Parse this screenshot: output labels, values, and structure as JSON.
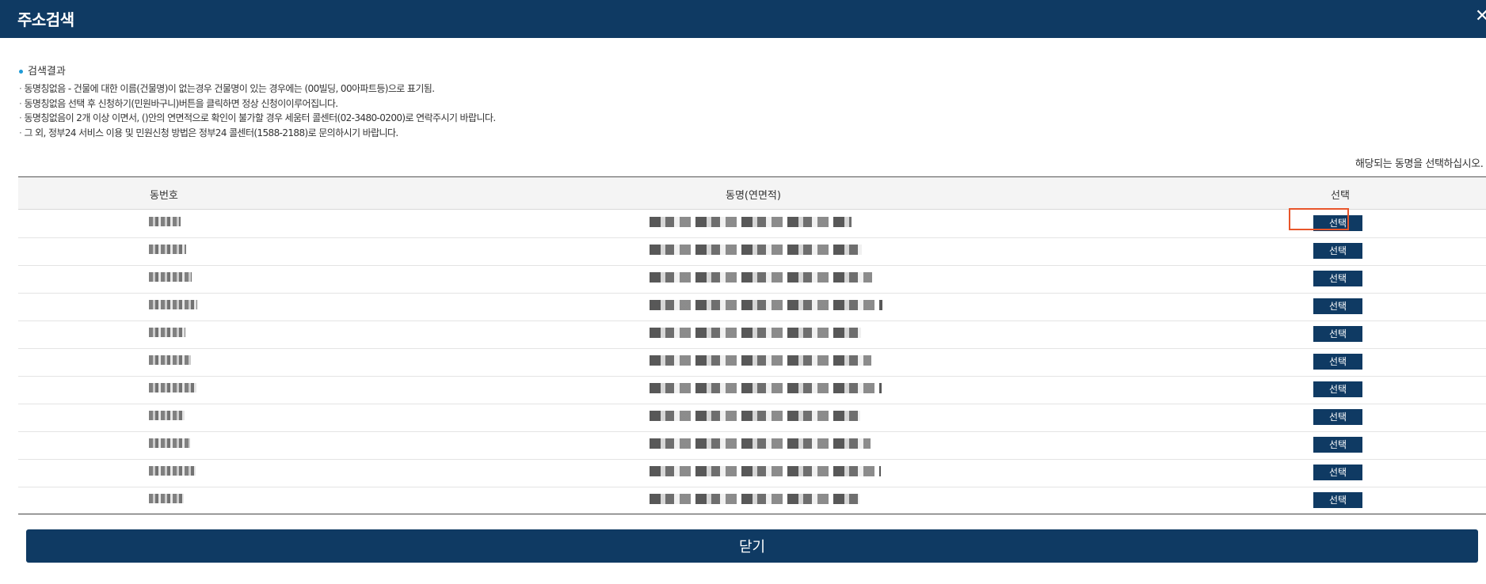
{
  "dialog": {
    "title": "주소검색",
    "close_icon": "✕"
  },
  "results": {
    "heading": "검색결과",
    "notes": [
      "동명칭없음 - 건물에 대한 이름(건물명)이 없는경우 건물명이 있는 경우에는 (00빌딩, 00아파트등)으로 표기됨.",
      "동명칭없음 선택 후 신청하기(민원바구니)버튼을 클릭하면 정상 신청이이루어집니다.",
      "동명칭없음이 2개 이상 이면서, ()안의 연면적으로 확인이 불가할 경우 세움터 콜센터(02-3480-0200)로 연락주시기 바랍니다.",
      "그 외, 정부24 서비스 이용 및 민원신청 방법은 정부24 콜센터(1588-2188)로 문의하시기 바랍니다."
    ],
    "instruction": "해당되는 동명을 선택하십시오."
  },
  "table": {
    "headers": {
      "number": "동번호",
      "name": "동명(연면적)",
      "select": "선택"
    },
    "rows": [
      {
        "select_label": "선택"
      },
      {
        "select_label": "선택"
      },
      {
        "select_label": "선택"
      },
      {
        "select_label": "선택"
      },
      {
        "select_label": "선택"
      },
      {
        "select_label": "선택"
      },
      {
        "select_label": "선택"
      },
      {
        "select_label": "선택"
      },
      {
        "select_label": "선택"
      },
      {
        "select_label": "선택"
      },
      {
        "select_label": "선택"
      }
    ]
  },
  "footer": {
    "close_label": "닫기"
  },
  "colors": {
    "primary": "#0f3a63",
    "accent_dot": "#1e9bd7",
    "highlight": "#e8552a"
  }
}
